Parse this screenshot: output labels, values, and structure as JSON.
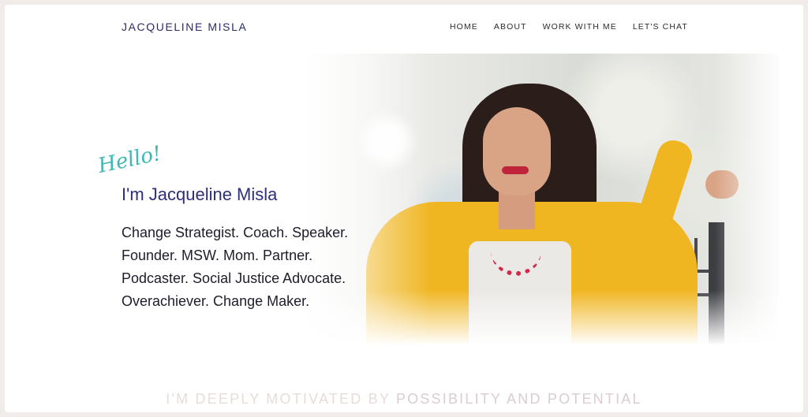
{
  "header": {
    "logo": "JACQUELINE MISLA",
    "nav": [
      {
        "label": "HOME"
      },
      {
        "label": "ABOUT"
      },
      {
        "label": "WORK WITH ME"
      },
      {
        "label": "LET'S CHAT"
      }
    ]
  },
  "hero": {
    "greeting": "Hello!",
    "name": "I'm Jacqueline Misla",
    "tagline_lines": [
      "Change Strategist. Coach. Speaker.",
      "Founder. MSW. Mom. Partner.",
      "Podcaster. Social Justice Advocate.",
      "Overachiever. Change Maker."
    ]
  },
  "section": {
    "heading_lead": "I'M DEEPLY MOTIVATED BY",
    "heading_emphasis": "POSSIBILITY AND POTENTIAL"
  },
  "colors": {
    "brand_navy": "#2e2e7a",
    "accent_teal": "#3fb8b4",
    "jacket_yellow": "#f0b622"
  }
}
